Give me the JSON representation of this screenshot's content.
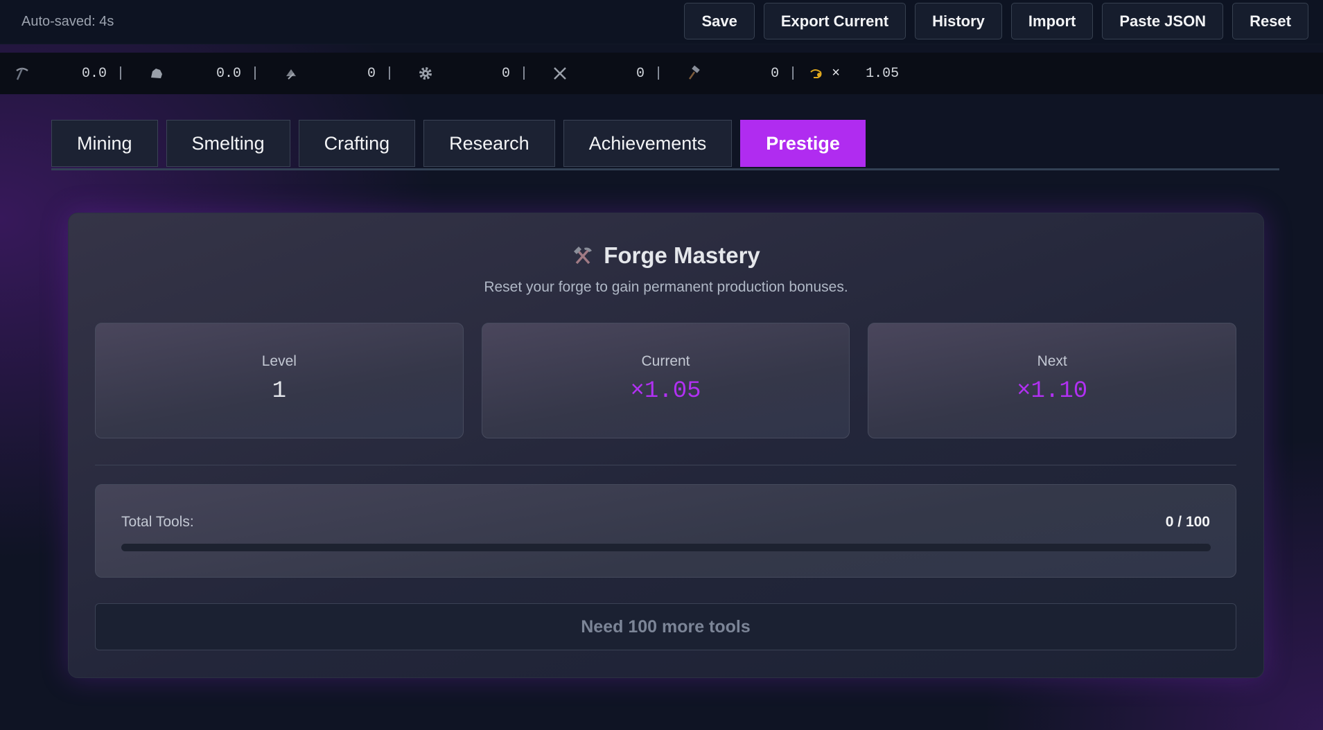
{
  "header": {
    "autosave": "Auto-saved: 4s",
    "buttons": {
      "save": "Save",
      "export": "Export Current",
      "history": "History",
      "import": "Import",
      "paste": "Paste JSON",
      "reset": "Reset"
    }
  },
  "resources": [
    {
      "icon": "pickaxe-icon",
      "value": "0.0"
    },
    {
      "icon": "ore-icon",
      "value": "0.0"
    },
    {
      "icon": "ingot-icon",
      "value": "0"
    },
    {
      "icon": "gear-icon",
      "value": "0"
    },
    {
      "icon": "crossed-swords-icon",
      "value": "0"
    },
    {
      "icon": "hammer-icon",
      "value": "0"
    }
  ],
  "multiplier": {
    "icon": "hand-coin-icon",
    "symbol": "×",
    "value": "1.05"
  },
  "tabs": [
    "Mining",
    "Smelting",
    "Crafting",
    "Research",
    "Achievements",
    "Prestige"
  ],
  "active_tab": "Prestige",
  "panel": {
    "icon": "hammer-pick-icon",
    "title": "Forge Mastery",
    "subtitle": "Reset your forge to gain permanent production bonuses.",
    "stats": {
      "level": {
        "label": "Level",
        "value": "1"
      },
      "current": {
        "label": "Current",
        "value": "×1.05"
      },
      "next": {
        "label": "Next",
        "value": "×1.10"
      }
    },
    "progress": {
      "label": "Total Tools:",
      "value": "0 / 100",
      "fraction": 0
    },
    "action": "Need 100 more tools"
  },
  "colors": {
    "accent": "#b02cf0",
    "background": "#0f1424"
  }
}
